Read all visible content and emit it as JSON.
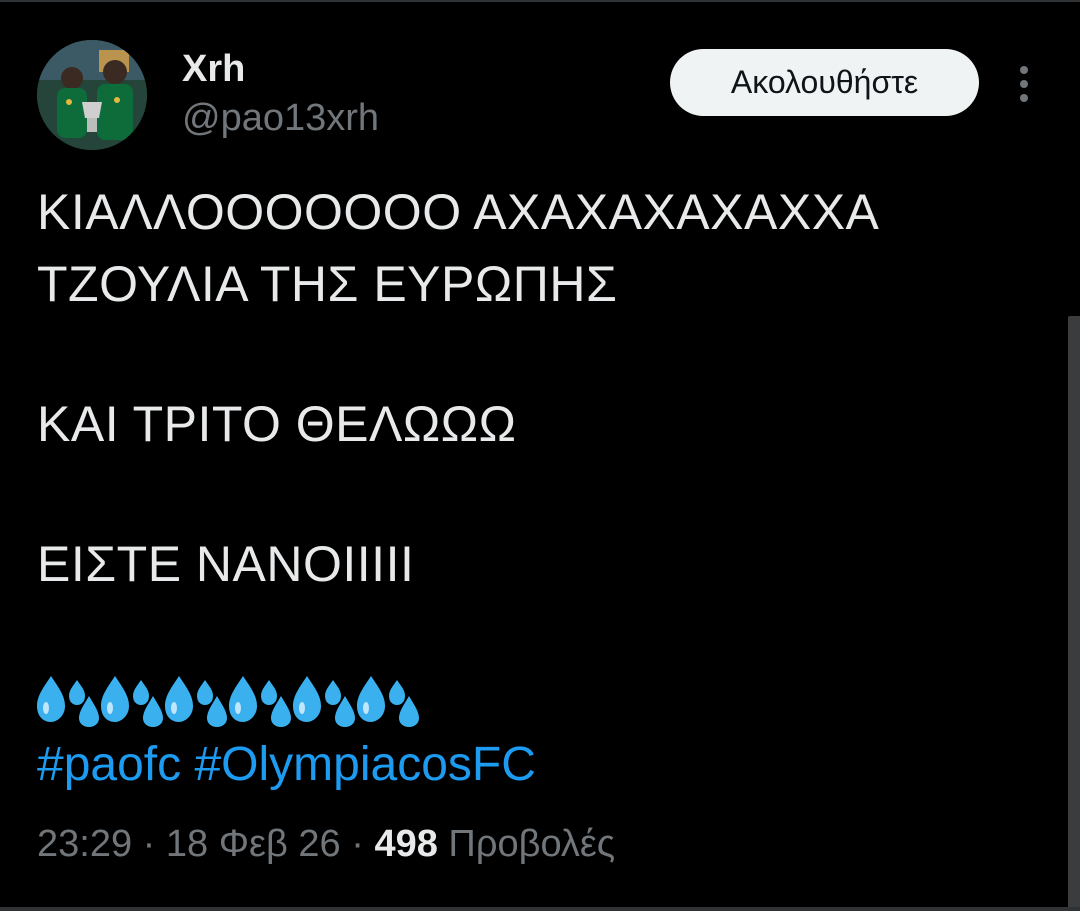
{
  "author": {
    "display_name": "Xrh",
    "handle": "@pao13xrh",
    "avatar_icon": "profile-photo-avatar"
  },
  "actions": {
    "follow_label": "Ακολουθήστε",
    "more_icon": "more-vertical-icon"
  },
  "tweet": {
    "lines": [
      "ΚΙΑΛΛΟΟΟΟΟΟΟ ΑΧΑΧΑΧΑΧΑΧΧΑ",
      "ΤΖΟΥΛΙΑ ΤΗΣ ΕΥΡΩΠΗΣ",
      "ΚΑΙ ΤΡΙΤΟ ΘΕΛΩΩΩ",
      "ΕΙΣΤΕ ΝΑΝΟΙΙΙΙΙ"
    ],
    "emoji_icon": "sweat-droplets-icon",
    "emoji_count": 6,
    "hashtags": [
      "#paofc",
      "#OlympiacosFC"
    ]
  },
  "meta": {
    "time": "23:29",
    "separator": "·",
    "date": "18 Φεβ 26",
    "views_count": "498",
    "views_label": "Προβολές"
  },
  "colors": {
    "background": "#000000",
    "text_primary": "#e7e9ea",
    "text_secondary": "#71767b",
    "link": "#1d9bf0",
    "follow_bg": "#eff3f4",
    "emoji_blue": "#3ab0ee"
  }
}
